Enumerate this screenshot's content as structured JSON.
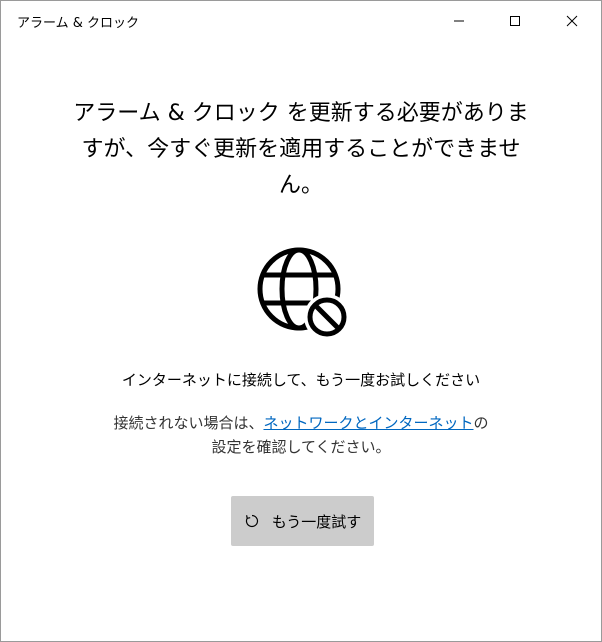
{
  "window": {
    "title": "アラーム & クロック"
  },
  "icons": {
    "minimize": "minimize-icon",
    "maximize": "maximize-icon",
    "close": "close-icon",
    "globe": "globe-blocked-icon",
    "refresh": "refresh-icon"
  },
  "main": {
    "headline_line1": "アラーム & クロック を更新する必要がありま",
    "headline_line2": "すが、今すぐ更新を適用することができませ",
    "headline_line3": "ん。",
    "connect_message": "インターネットに接続して、もう一度お試しください",
    "hint_prefix": "接続されない場合は、",
    "hint_link": "ネットワークとインターネット",
    "hint_suffix": "の",
    "hint_line2": "設定を確認してください。",
    "retry_label": "もう一度試す"
  },
  "colors": {
    "link": "#0067c0",
    "button_bg": "#cccccc"
  }
}
